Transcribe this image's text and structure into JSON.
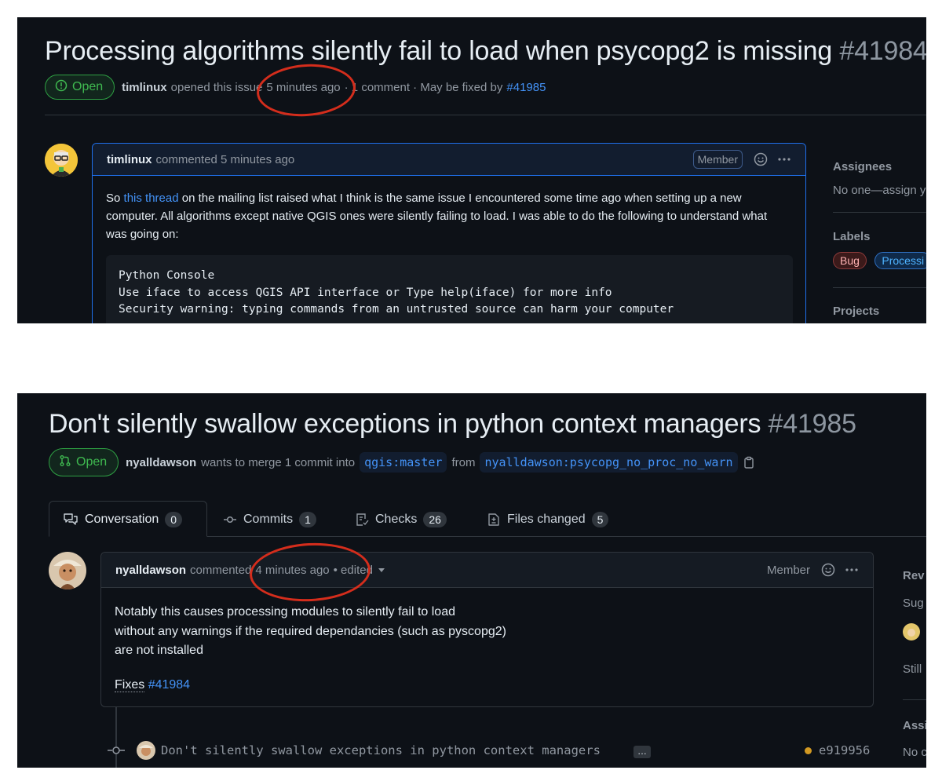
{
  "issue": {
    "title": "Processing algorithms silently fail to load when psycopg2 is missing",
    "number": "#41984",
    "status": "Open",
    "author": "timlinux",
    "opened_text": "opened this issue",
    "opened_time": "5 minutes ago",
    "comments_text": "· 1 comment · May be fixed by",
    "fix_link": "#41985",
    "comment": {
      "author": "timlinux",
      "action": "commented 5 minutes ago",
      "role": "Member",
      "p1_before": "So",
      "p1_link": "this thread",
      "p1_after": "on the mailing list raised what I think is the same issue I encountered some time ago when setting up a new computer. All algorithms except native QGIS ones were silently failing to load. I was able to do the following to understand what was going on:",
      "code_lines": [
        "Python Console",
        "Use iface to access QGIS API interface or Type help(iface) for more info",
        "Security warning: typing commands from an untrusted source can harm your computer"
      ]
    },
    "sidebar": {
      "assignees_heading": "Assignees",
      "assignees_value": "No one—assign y",
      "labels_heading": "Labels",
      "labels": [
        "Bug",
        "Processi"
      ],
      "projects_heading": "Projects"
    }
  },
  "pr": {
    "title": "Don't silently swallow exceptions in python context managers",
    "number": "#41985",
    "status": "Open",
    "author": "nyalldawson",
    "merge_text": "wants to merge 1 commit into",
    "base_branch": "qgis:master",
    "from_text": "from",
    "head_branch": "nyalldawson:psycopg_no_proc_no_warn",
    "tabs": [
      {
        "label": "Conversation",
        "count": "0"
      },
      {
        "label": "Commits",
        "count": "1"
      },
      {
        "label": "Checks",
        "count": "26"
      },
      {
        "label": "Files changed",
        "count": "5"
      }
    ],
    "comment": {
      "author": "nyalldawson",
      "action": "commented",
      "time": "4 minutes ago",
      "edited": "• edited",
      "role": "Member",
      "lines": [
        "Notably this causes processing modules to silently fail to load",
        "without any warnings if the required dependancies (such as pyscopg2)",
        "are not installed"
      ],
      "fixes_label": "Fixes",
      "fixes_link": "#41984"
    },
    "commit": {
      "message": "Don't silently swallow exceptions in python context managers",
      "ellipsis": "…",
      "sha": "e919956"
    },
    "sidebar": {
      "rev": "Rev",
      "sug": "Sug",
      "still": "Still",
      "assi": "Assi",
      "no": "No c"
    }
  },
  "colors": {
    "background": "#0d1117",
    "accent_blue": "#4493f8",
    "open_green": "#3fb950",
    "annotation_red": "#d42d1c"
  }
}
